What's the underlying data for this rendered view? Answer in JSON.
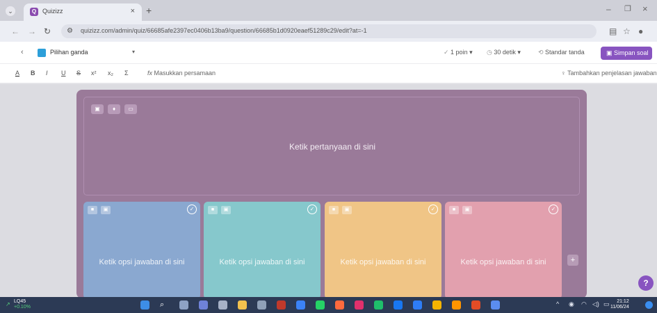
{
  "browser": {
    "tab_title": "Quizizz",
    "tab_favicon": "Q",
    "url": "quizizz.com/admin/quiz/66685afe2397ec0406b13ba9/question/66685b1d0920eaef51289c29/edit?at=-1"
  },
  "toolbar": {
    "question_type": "Pilihan ganda",
    "points": "1 poin",
    "time": "30 detik",
    "answer_mark": "Standar tanda",
    "save_label": "Simpan soal"
  },
  "format_bar": {
    "equation_label": "Masukkan persamaan",
    "explanation_label": "Tambahkan penjelasan jawaban"
  },
  "editor": {
    "question_placeholder": "Ketik pertanyaan di sini",
    "options": [
      {
        "placeholder": "Ketik opsi jawaban di sini",
        "color": "#8aa8d0"
      },
      {
        "placeholder": "Ketik opsi jawaban di sini",
        "color": "#86c8cc"
      },
      {
        "placeholder": "Ketik opsi jawaban di sini",
        "color": "#f0c586"
      },
      {
        "placeholder": "Ketik opsi jawaban di sini",
        "color": "#e2a0ae"
      }
    ],
    "add_option": "+",
    "help": "?"
  },
  "taskbar": {
    "stock_name": "LQ45",
    "stock_change": "+0.10%",
    "time": "21:12",
    "date": "11/06/24"
  },
  "colors": {
    "accent": "#8854c0",
    "question_card": "#9a7a99"
  }
}
